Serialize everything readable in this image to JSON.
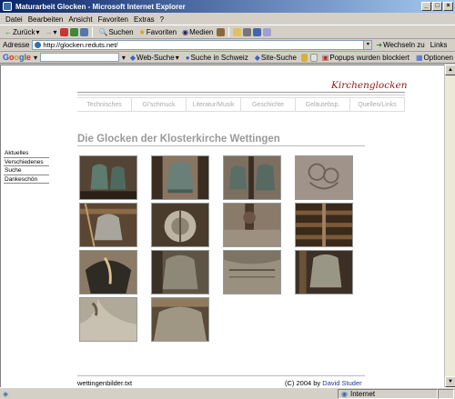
{
  "window": {
    "title": "Maturarbeit Glocken - Microsoft Internet Explorer"
  },
  "menu": {
    "items": [
      "Datei",
      "Bearbeiten",
      "Ansicht",
      "Favoriten",
      "Extras",
      "?"
    ]
  },
  "toolbar": {
    "back": "Zurück",
    "search": "Suchen",
    "favorites": "Favoriten",
    "media": "Medien"
  },
  "address": {
    "label": "Adresse",
    "url": "http://glocken.reduts.net/",
    "go": "Wechseln zu",
    "links": "Links"
  },
  "google": {
    "logo": "Google",
    "web_search": "Web-Suche",
    "search_ch": "Suche in Schweiz",
    "site_search": "Site-Suche",
    "popups": "Popups wurden blockiert",
    "options": "Optionen"
  },
  "site": {
    "brand": "Kirchenglocken",
    "nav": [
      "Technisches",
      "Gl'schmuck",
      "Literatur/Musik",
      "Geschichte",
      "Geläutebsp.",
      "Quellen/Links"
    ],
    "side_menu": [
      "Aktuelles",
      "Verschiedenes",
      "Suche",
      "Dankeschön"
    ],
    "heading": "Die Glocken der Klosterkirche Wettingen",
    "footer_left": "wettingenbilder.txt",
    "footer_copy": "(C) 2004 by ",
    "footer_author": "David Studer"
  },
  "status": {
    "text": "",
    "zone": "Internet"
  },
  "colors": {
    "titlebar": "#0a246a",
    "brand": "#8b1a1a",
    "link": "#22339a",
    "heading": "#9a9a9a"
  }
}
